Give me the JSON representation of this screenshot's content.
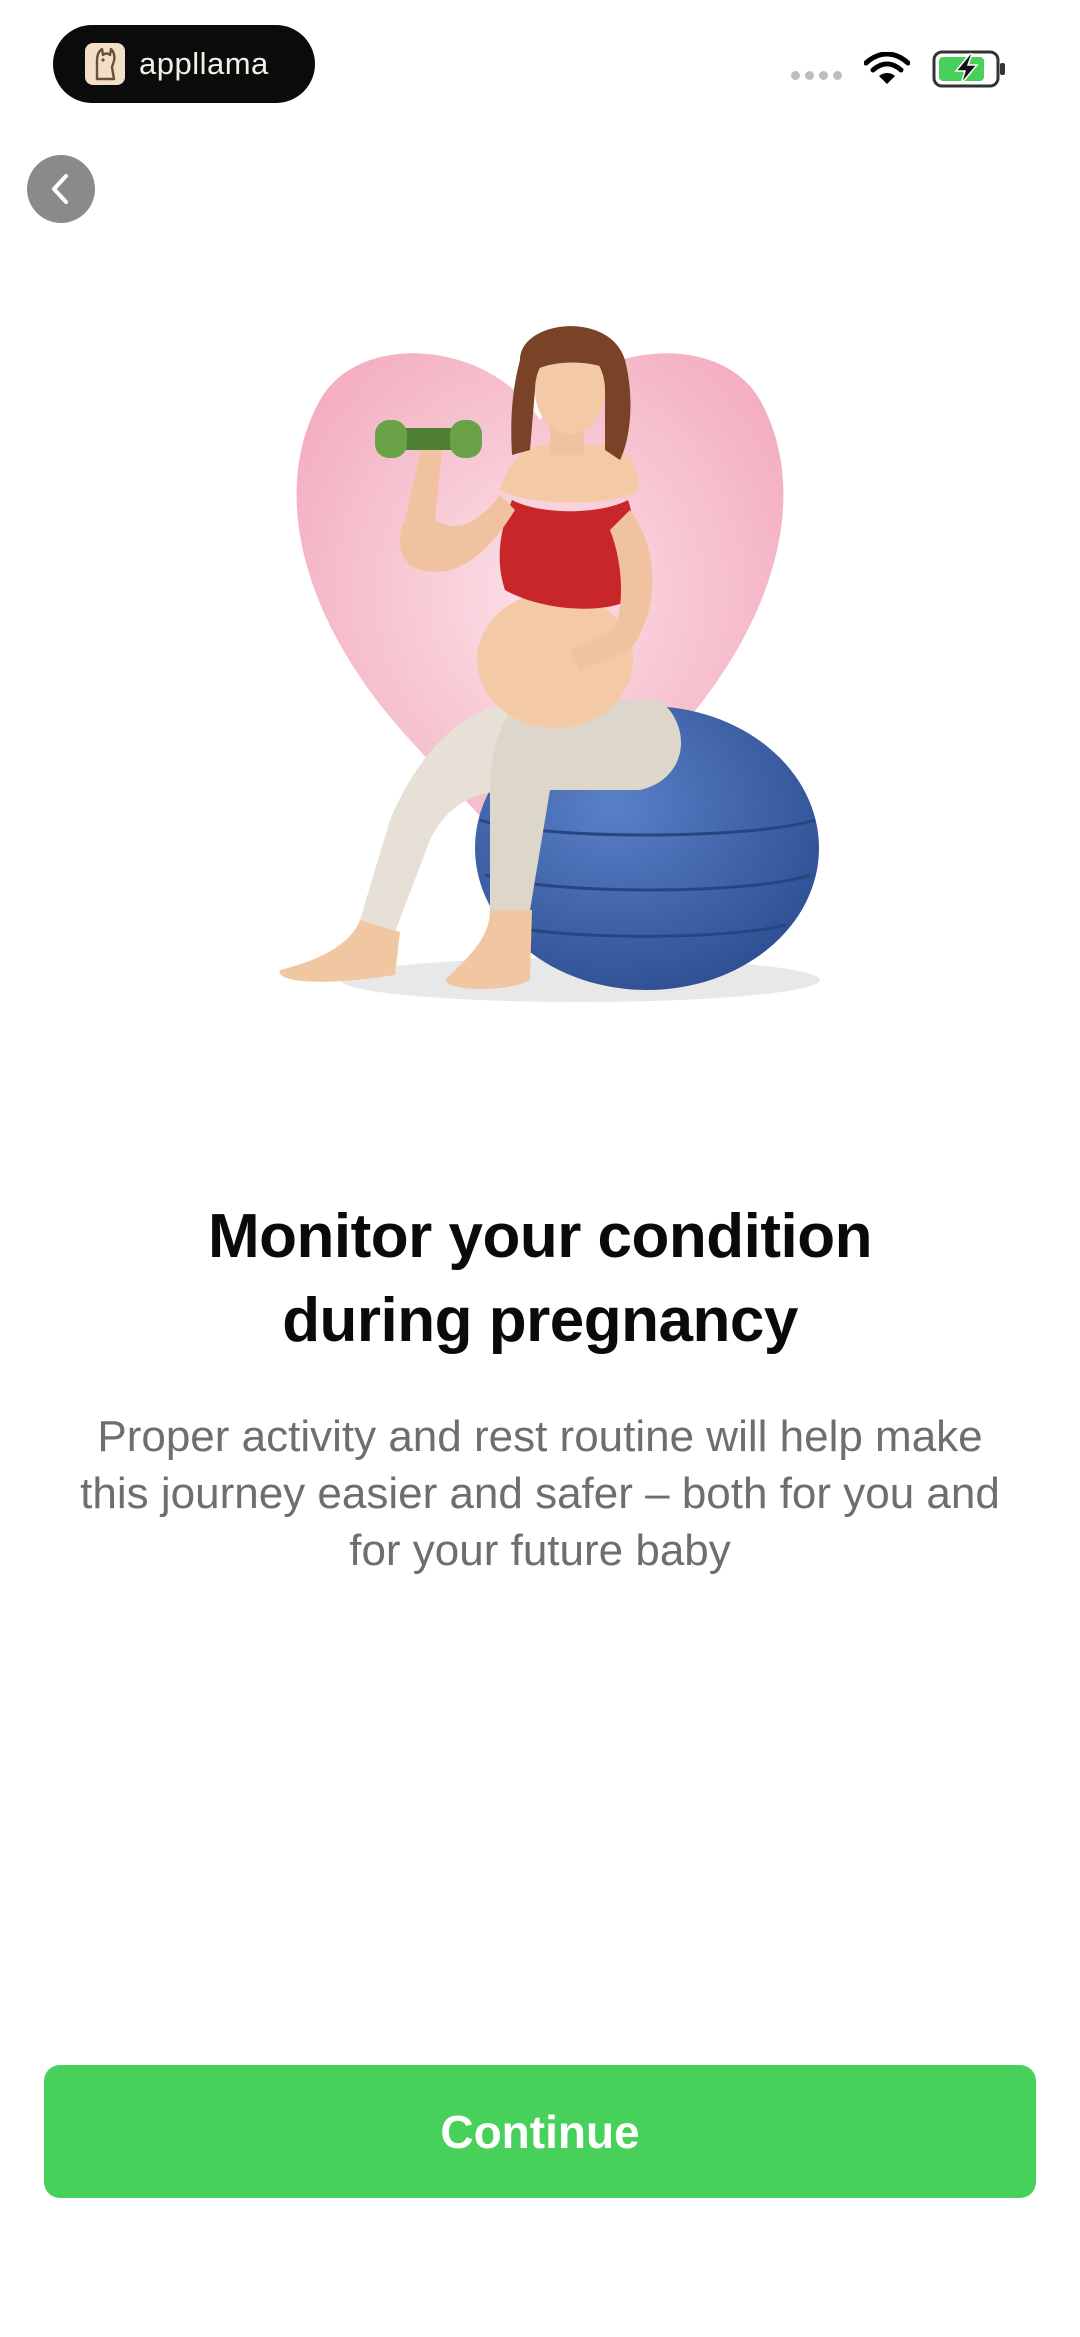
{
  "status_bar": {
    "brand_name": "appllama",
    "logo_icon": "llama-logo-icon",
    "signal_icon": "cellular-signal-icon",
    "wifi_icon": "wifi-icon",
    "battery_icon": "battery-charging-icon",
    "battery_color": "#47d15b"
  },
  "navigation": {
    "back_icon": "chevron-left-icon"
  },
  "illustration": {
    "subject": "pregnant-woman-exercising-illustration",
    "heart_color": "#f5b8c6",
    "ball_color": "#4066ad",
    "dumbbell_color": "#6aa247",
    "top_color": "#c9262a"
  },
  "content": {
    "title_line1": "Monitor your condition",
    "title_line2": "during pregnancy",
    "subtitle_line1": "Proper activity and rest routine will help make",
    "subtitle_line2": "this journey easier and safer – both for you and",
    "subtitle_line3": "for your future baby"
  },
  "actions": {
    "continue_label": "Continue",
    "accent_color": "#47d15b"
  }
}
